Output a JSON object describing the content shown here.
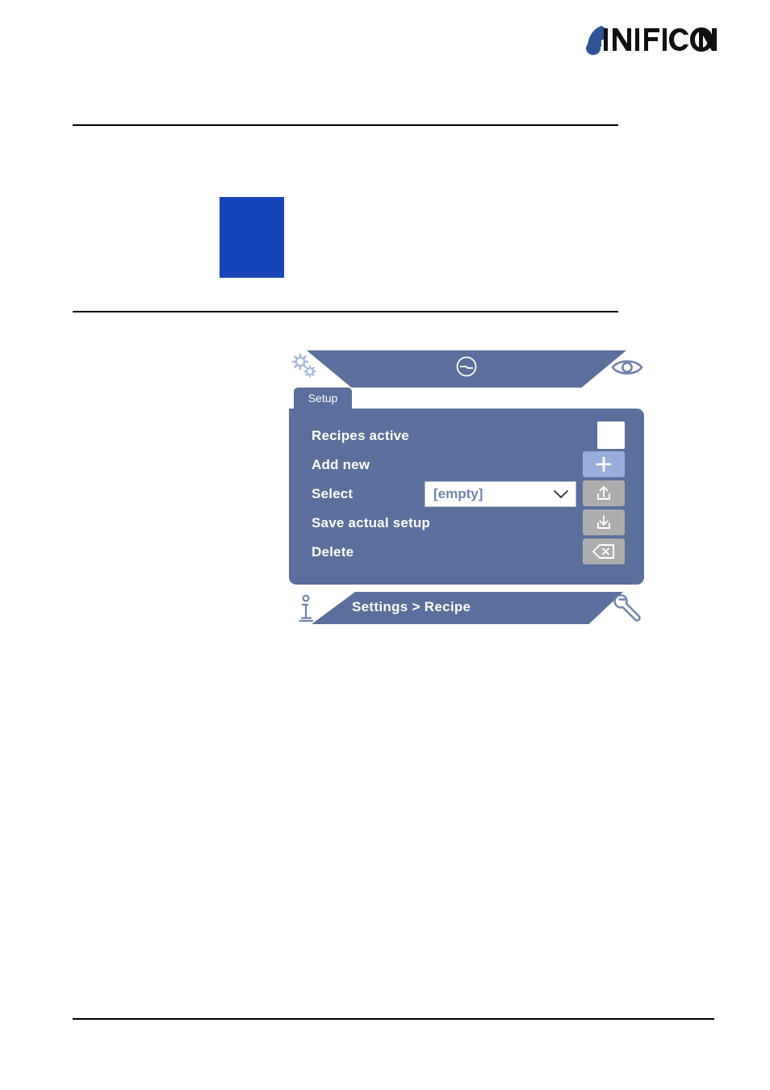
{
  "brand": {
    "name": "INFICON",
    "logo_icon": "inficon-logo",
    "mark_color": "#2f5496",
    "wordmark_color": "#111111"
  },
  "page": {
    "placeholder_block_color": "#1744b8",
    "rule_color": "#000000"
  },
  "device_ui": {
    "topbar": {
      "left_icon": "gears-icon",
      "center_icon": "leak-rate-icon",
      "right_icon": "eye-icon",
      "bar_color": "#5a6f9c"
    },
    "tabs": [
      {
        "label": "Setup",
        "active": true
      }
    ],
    "rows": [
      {
        "label": "Recipes active",
        "control": "checkbox",
        "control_icon": "checkbox-unchecked-icon",
        "checked": false
      },
      {
        "label": "Add new",
        "control": "button",
        "control_icon": "plus-icon",
        "button_color": "#97adda"
      },
      {
        "label": "Select",
        "control": "button",
        "control_icon": "upload-icon",
        "button_color": "#adadad",
        "select": {
          "value": "[empty]",
          "chevron_icon": "chevron-down-icon",
          "options": [
            "[empty]"
          ]
        }
      },
      {
        "label": "Save actual setup",
        "control": "button",
        "control_icon": "download-icon",
        "button_color": "#adadad"
      },
      {
        "label": "Delete",
        "control": "button",
        "control_icon": "backspace-delete-icon",
        "button_color": "#adadad"
      }
    ],
    "bottombar": {
      "left_icon": "info-icon",
      "breadcrumb": "Settings > Recipe",
      "right_icon": "wrench-icon",
      "bar_color": "#5a6f9c"
    }
  }
}
